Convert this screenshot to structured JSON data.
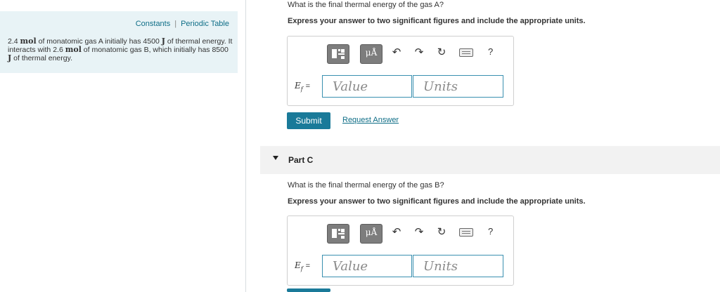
{
  "sidebar": {
    "links": {
      "constants": "Constants",
      "periodic_table": "Periodic Table",
      "separator": "|"
    },
    "problem": {
      "p1_num": "2.4",
      "mol_unit": "mol",
      "p1_rest": "of monatomic gas A initially has 4500",
      "j_unit": "J",
      "p2": "of thermal energy. It interacts with 2.6",
      "p3": "of monatomic gas B, which initially has 8500",
      "p4": "of thermal energy."
    }
  },
  "partB": {
    "question": "What is the final thermal energy of the gas A?",
    "instruction": "Express your answer to two significant figures and include the appropriate units.",
    "answer": {
      "var": "E",
      "sub": "f",
      "equals": "=",
      "value_placeholder": "Value",
      "units_placeholder": "Units"
    },
    "submit_label": "Submit",
    "request_label": "Request Answer"
  },
  "partC": {
    "title": "Part C",
    "question": "What is the final thermal energy of the gas B?",
    "instruction": "Express your answer to two significant figures and include the appropriate units.",
    "answer": {
      "var": "E",
      "sub": "f",
      "equals": "=",
      "value_placeholder": "Value",
      "units_placeholder": "Units"
    }
  },
  "toolbar": {
    "units_button_label": "μÅ",
    "undo_icon": "↶",
    "redo_icon": "↷",
    "reset_icon": "↻",
    "help_label": "?"
  },
  "colors": {
    "accent": "#1a7a99",
    "link": "#0f6e87",
    "panel": "#e8f3f6",
    "input_border": "#3a90b0"
  }
}
